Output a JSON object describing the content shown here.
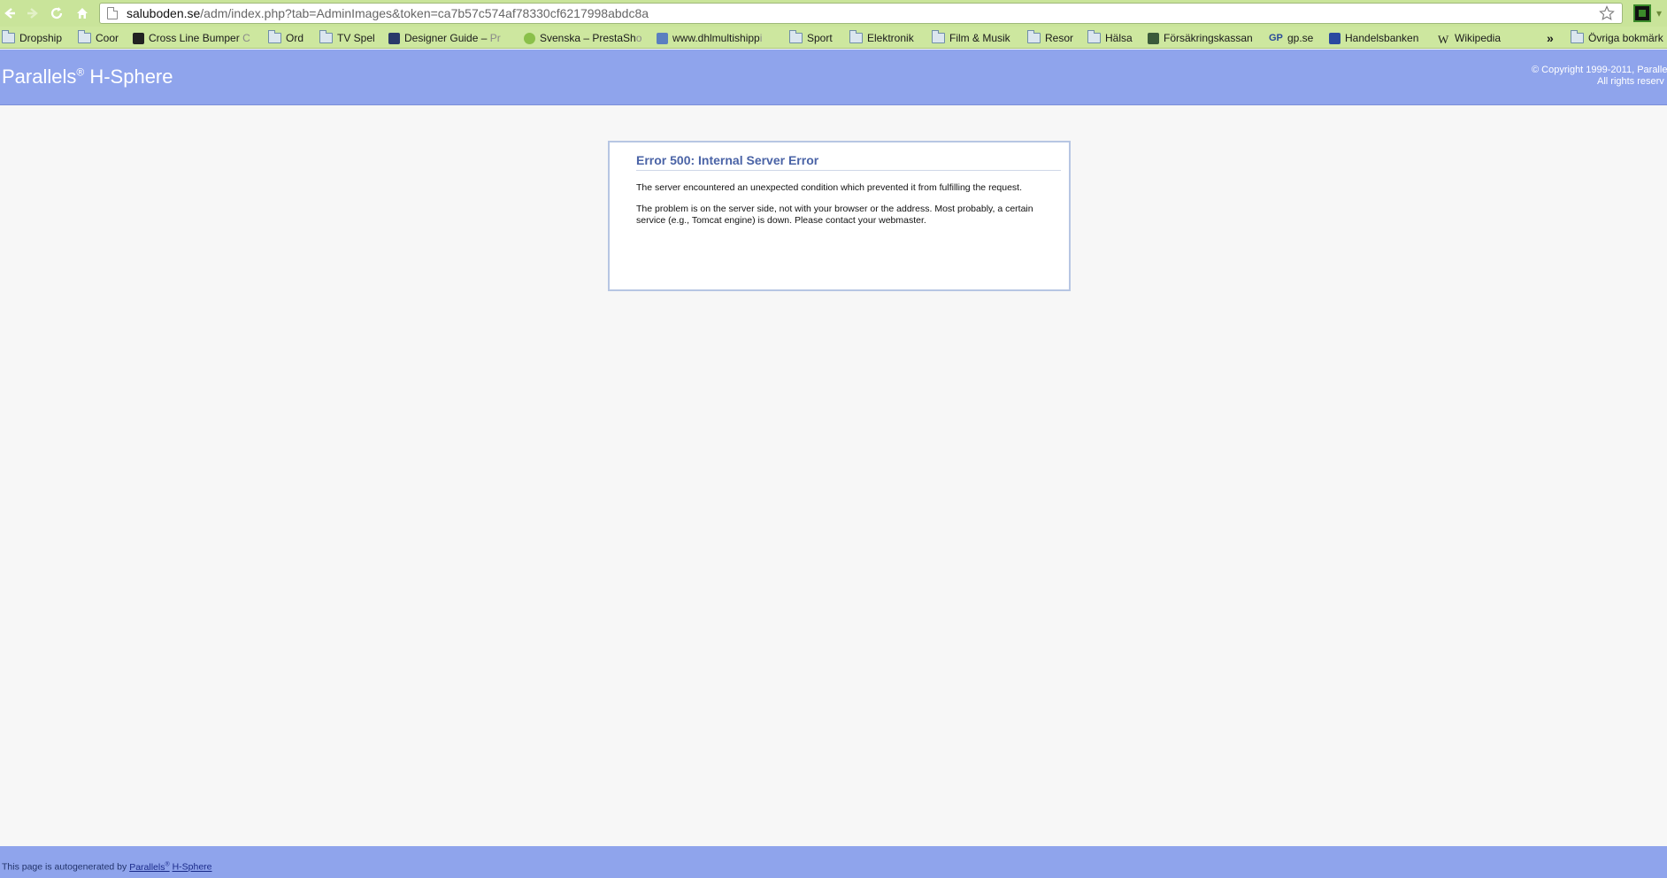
{
  "browser": {
    "url_host": "saluboden.se",
    "url_path": "/adm/index.php?tab=AdminImages&token=ca7b57c574af78330cf6217998abdc8a",
    "bookmarks": [
      {
        "label": "Dropship",
        "icon": "folder-icon"
      },
      {
        "label": "Coor",
        "icon": "folder-icon"
      },
      {
        "label": "Cross Line Bumper",
        "fade": "C",
        "icon": "site-icon"
      },
      {
        "label": "Ord",
        "icon": "folder-icon"
      },
      {
        "label": "TV Spel",
        "icon": "folder-icon"
      },
      {
        "label": "Designer Guide –",
        "fade": "Pr",
        "icon": "site-icon"
      },
      {
        "label": "Svenska – PrestaSh",
        "fade": "o",
        "icon": "site-icon"
      },
      {
        "label": "www.dhlmultishipp",
        "fade": "i",
        "icon": "site-icon"
      },
      {
        "label": "Sport",
        "icon": "folder-icon"
      },
      {
        "label": "Elektronik",
        "icon": "folder-icon"
      },
      {
        "label": "Film & Musik",
        "icon": "folder-icon"
      },
      {
        "label": "Resor",
        "icon": "folder-icon"
      },
      {
        "label": "Hälsa",
        "icon": "folder-icon"
      },
      {
        "label": "Försäkringskassan",
        "icon": "site-icon"
      },
      {
        "label": "gp.se",
        "icon": "site-icon"
      },
      {
        "label": "Handelsbanken",
        "icon": "site-icon"
      },
      {
        "label": "Wikipedia",
        "icon": "site-icon"
      }
    ],
    "more_bookmarks_glyph": "»",
    "other_bookmarks_label": "Övriga bokmärk"
  },
  "header": {
    "brand_name": "Parallels",
    "brand_registered": "®",
    "brand_product": " H-Sphere",
    "copyright_line1": "© Copyright 1999-2011, Paralle",
    "copyright_line2": "All rights reserv"
  },
  "error": {
    "title": "Error 500: Internal Server Error",
    "paragraph1": "The server encountered an unexpected condition which prevented it from fulfilling the request.",
    "paragraph2": "The problem is on the server side, not with your browser or the address. Most probably, a certain service (e.g., Tomcat engine) is down. Please contact your webmaster."
  },
  "footer": {
    "prefix": "This page is autogenerated by ",
    "link_brand": "Parallels",
    "link_registered": "®",
    "link_product": "H-Sphere"
  },
  "colors": {
    "toolbar": "#c9e49a",
    "header": "#8fa4ec",
    "error_title": "#4a63a6"
  }
}
